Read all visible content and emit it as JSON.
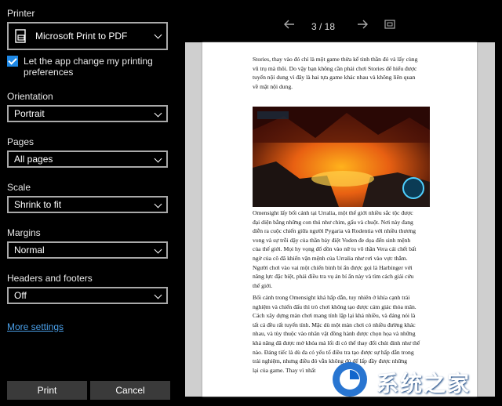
{
  "printer": {
    "label": "Printer",
    "value": "Microsoft Print to PDF",
    "checkbox_label_1": "Let the app change my printing",
    "checkbox_label_2": "preferences"
  },
  "orientation": {
    "label": "Orientation",
    "value": "Portrait"
  },
  "pages": {
    "label": "Pages",
    "value": "All pages"
  },
  "scale": {
    "label": "Scale",
    "value": "Shrink to fit"
  },
  "margins": {
    "label": "Margins",
    "value": "Normal"
  },
  "headers_footers": {
    "label": "Headers and footers",
    "value": "Off"
  },
  "more_settings": "More settings",
  "buttons": {
    "print": "Print",
    "cancel": "Cancel"
  },
  "preview": {
    "page_indicator": "3 / 18",
    "para1": [
      "Stories, thay vào đó chỉ là một game thừa kế tinh thần đó và lấy cùng",
      "vũ trụ mà thôi. Do vậy bạn không cần phải chơi Stories để hiểu được",
      "tuyến nội dung vì đây là hai tựa game khác nhau và không liên quan",
      "về mặt nội dung."
    ],
    "para2": [
      "Omensight lấy bối cảnh tại Urralia, một thế giới nhiều sắc tộc được",
      "đại diện bằng những con thú như chim, gấu và chuột. Nơi này đang",
      "diễn ra cuộc chiến giữa người Pygaria và Rodentia với nhiều thương",
      "vong và sự trỗi dậy của thần bảy điệt Voden đe dọa đến sinh mệnh",
      "của thế giới. Mọi hy vọng đổ dồn vào nữ tu võ thần Vera cái chết bất",
      "ngờ của cô đã khiến vận mệnh của Urralia như rơi vào vực thẳm.",
      "Người chơi vào vai một chiến binh bí ẩn được gọi là Harbinger với",
      "năng lực đặc biệt, phải điều tra vụ án bí ẩn này và tìm cách giải cứu",
      "thế giới."
    ],
    "para3": [
      "Bối cảnh trong Omensight khá hấp dẫn, tuy nhiên ở khía cạnh trải",
      "nghiệm và chiến đấu thì trò chơi không tạo được cảm giác thỏa mãn.",
      "Cách xây dựng màn chơi mang tính lặp lại khá nhiều, và đáng nói là",
      "tất cả đều rất tuyến tính. Mặc dù một màn chơi có nhiều đường khác",
      "nhau, và tùy thuộc vào nhân vật đồng hành được chọn họa và những",
      "khả năng đã được mở khóa mà lối đi có thể thay đổi chút đỉnh như thế",
      "nào. Đáng tiếc là dù đa có yếu tố điều tra tạo được sự hấp dẫn trong",
      "trải nghiệm, nhưng điều đó vẫn không đủ để lấp đầy được những",
      "lại của game. Thay vì nhất"
    ]
  },
  "watermark": "系统之家",
  "colors": {
    "accent": "#1e88e5",
    "background": "#000000",
    "button": "#3a3a3a"
  }
}
